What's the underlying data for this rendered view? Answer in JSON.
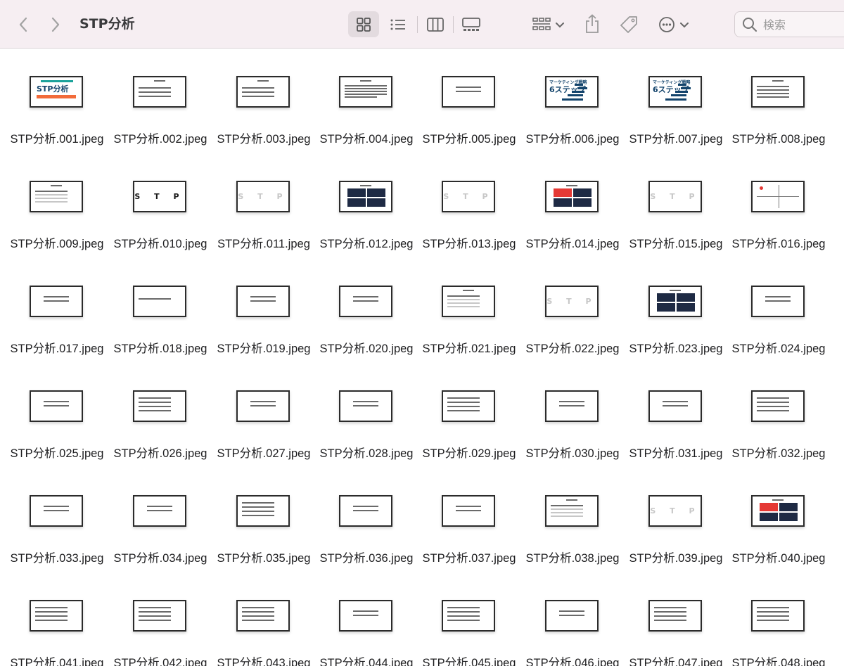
{
  "toolbar": {
    "title": "STP分析",
    "back_icon": "chevron-left-icon",
    "forward_icon": "chevron-right-icon",
    "views": [
      "icon-view",
      "list-view",
      "column-view",
      "gallery-view"
    ],
    "active_view": "icon-view",
    "search_placeholder": "検索"
  },
  "files": [
    {
      "name": "STP分析.001.jpeg",
      "thumb": "cover"
    },
    {
      "name": "STP分析.002.jpeg",
      "thumb": "text-box"
    },
    {
      "name": "STP分析.003.jpeg",
      "thumb": "text-box"
    },
    {
      "name": "STP分析.004.jpeg",
      "thumb": "text-dense"
    },
    {
      "name": "STP分析.005.jpeg",
      "thumb": "text-center"
    },
    {
      "name": "STP分析.006.jpeg",
      "thumb": "marketing-steps"
    },
    {
      "name": "STP分析.007.jpeg",
      "thumb": "marketing-steps"
    },
    {
      "name": "STP分析.008.jpeg",
      "thumb": "agenda"
    },
    {
      "name": "STP分析.009.jpeg",
      "thumb": "agenda-faded"
    },
    {
      "name": "STP分析.010.jpeg",
      "thumb": "stp"
    },
    {
      "name": "STP分析.011.jpeg",
      "thumb": "stp-faded"
    },
    {
      "name": "STP分析.012.jpeg",
      "thumb": "four-boxes"
    },
    {
      "name": "STP分析.013.jpeg",
      "thumb": "stp-faded"
    },
    {
      "name": "STP分析.014.jpeg",
      "thumb": "four-boxes-red"
    },
    {
      "name": "STP分析.015.jpeg",
      "thumb": "stp-faded"
    },
    {
      "name": "STP分析.016.jpeg",
      "thumb": "axis"
    },
    {
      "name": "STP分析.017.jpeg",
      "thumb": "text-center"
    },
    {
      "name": "STP分析.018.jpeg",
      "thumb": "text-short"
    },
    {
      "name": "STP分析.019.jpeg",
      "thumb": "text-center"
    },
    {
      "name": "STP分析.020.jpeg",
      "thumb": "text-center"
    },
    {
      "name": "STP分析.021.jpeg",
      "thumb": "agenda-faded"
    },
    {
      "name": "STP分析.022.jpeg",
      "thumb": "stp-faded"
    },
    {
      "name": "STP分析.023.jpeg",
      "thumb": "four-boxes"
    },
    {
      "name": "STP分析.024.jpeg",
      "thumb": "text-center"
    },
    {
      "name": "STP分析.025.jpeg",
      "thumb": "text-center"
    },
    {
      "name": "STP分析.026.jpeg",
      "thumb": "list"
    },
    {
      "name": "STP分析.027.jpeg",
      "thumb": "text-center"
    },
    {
      "name": "STP分析.028.jpeg",
      "thumb": "text-center"
    },
    {
      "name": "STP分析.029.jpeg",
      "thumb": "list"
    },
    {
      "name": "STP分析.030.jpeg",
      "thumb": "text-center"
    },
    {
      "name": "STP分析.031.jpeg",
      "thumb": "text-center"
    },
    {
      "name": "STP分析.032.jpeg",
      "thumb": "list"
    },
    {
      "name": "STP分析.033.jpeg",
      "thumb": "text-center"
    },
    {
      "name": "STP分析.034.jpeg",
      "thumb": "text-center"
    },
    {
      "name": "STP分析.035.jpeg",
      "thumb": "list"
    },
    {
      "name": "STP分析.036.jpeg",
      "thumb": "text-center"
    },
    {
      "name": "STP分析.037.jpeg",
      "thumb": "text-center"
    },
    {
      "name": "STP分析.038.jpeg",
      "thumb": "agenda-faded"
    },
    {
      "name": "STP分析.039.jpeg",
      "thumb": "stp-faded"
    },
    {
      "name": "STP分析.040.jpeg",
      "thumb": "four-boxes-red"
    },
    {
      "name": "STP分析.041.jpeg",
      "thumb": "list"
    },
    {
      "name": "STP分析.042.jpeg",
      "thumb": "list"
    },
    {
      "name": "STP分析.043.jpeg",
      "thumb": "list"
    },
    {
      "name": "STP分析.044.jpeg",
      "thumb": "text-center"
    },
    {
      "name": "STP分析.045.jpeg",
      "thumb": "list"
    },
    {
      "name": "STP分析.046.jpeg",
      "thumb": "text-center"
    },
    {
      "name": "STP分析.047.jpeg",
      "thumb": "list"
    },
    {
      "name": "STP分析.048.jpeg",
      "thumb": "list"
    }
  ]
}
